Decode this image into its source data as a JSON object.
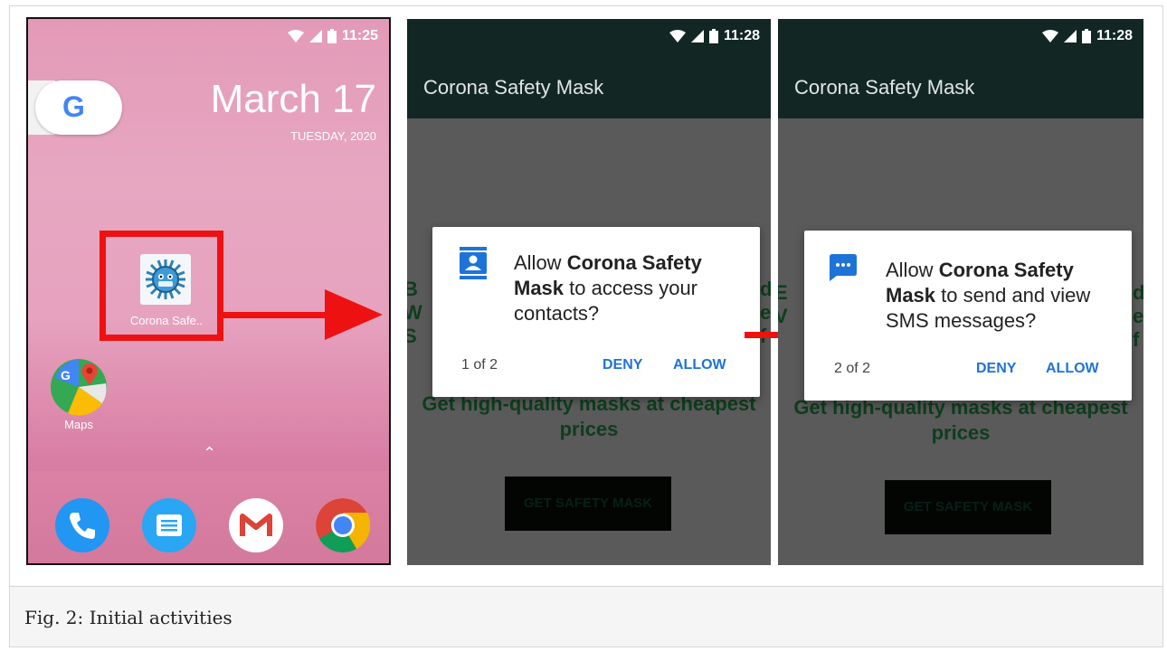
{
  "caption": "Fig. 2: Initial activities",
  "home": {
    "status_time": "11:25",
    "google_letter": "G",
    "date_main": "March 17",
    "date_sub": "TUESDAY, 2020",
    "app_label": "Corona Safe..",
    "maps_label": "Maps",
    "dock_apps": [
      "phone-icon",
      "messages-icon",
      "gmail-icon",
      "chrome-icon"
    ]
  },
  "screen_contacts": {
    "status_time": "11:28",
    "app_title": "Corona Safety Mask",
    "dialog_prefix": "Allow ",
    "dialog_app_name": "Corona Safety Mask",
    "dialog_suffix": " to access your contacts?",
    "counter": "1 of 2",
    "deny": "DENY",
    "allow": "ALLOW",
    "promo": "Get high-quality masks at cheapest prices",
    "button": "GET SAFETY MASK"
  },
  "screen_sms": {
    "status_time": "11:28",
    "app_title": "Corona Safety Mask",
    "dialog_prefix": "Allow ",
    "dialog_app_name": "Corona Safety Mask",
    "dialog_suffix": " to send and view SMS messages?",
    "counter": "2 of 2",
    "deny": "DENY",
    "allow": "ALLOW",
    "promo": "Get high-quality masks at cheapest prices",
    "button": "GET SAFETY MASK"
  },
  "colors": {
    "arrow": "#ee1111",
    "app_bar": "#122724",
    "dialog_button": "#1e73d8",
    "promo_text": "#0f3d1d"
  }
}
